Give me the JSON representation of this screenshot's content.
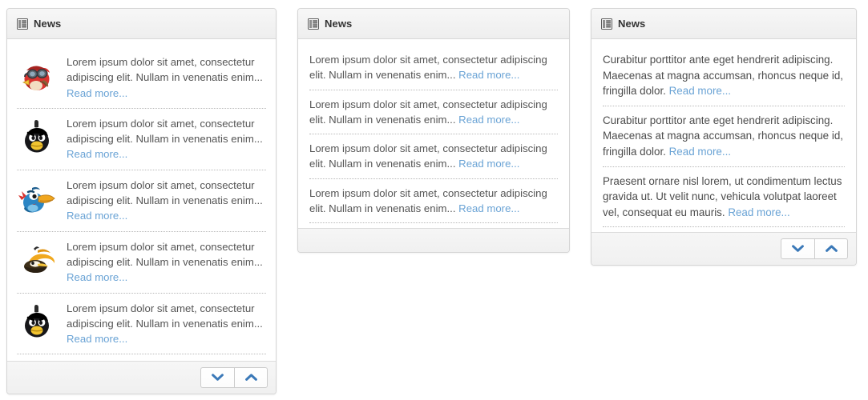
{
  "panels": [
    {
      "title": "News",
      "icon": "list-article-icon",
      "variant": "with-avatars",
      "items": [
        {
          "avatar": "red-bird-goggles-avatar",
          "text": "Lorem ipsum dolor sit amet, consectetur adipiscing elit. Nullam in venenatis enim... ",
          "read_more": "Read more..."
        },
        {
          "avatar": "black-bomb-bird-avatar",
          "text": "Lorem ipsum dolor sit amet, consectetur adipiscing elit. Nullam in venenatis enim... ",
          "read_more": "Read more..."
        },
        {
          "avatar": "blue-toucan-bird-avatar",
          "text": "Lorem ipsum dolor sit amet, consectetur adipiscing elit. Nullam in venenatis enim... ",
          "read_more": "Read more..."
        },
        {
          "avatar": "yellow-bird-avatar",
          "text": "Lorem ipsum dolor sit amet, consectetur adipiscing elit. Nullam in venenatis enim... ",
          "read_more": "Read more..."
        },
        {
          "avatar": "black-bomb-bird-avatar",
          "text": "Lorem ipsum dolor sit amet, consectetur adipiscing elit. Nullam in venenatis enim... ",
          "read_more": "Read more..."
        }
      ],
      "footer": {
        "has_buttons": true,
        "prev_icon": "chevron-down-icon",
        "next_icon": "chevron-up-icon"
      }
    },
    {
      "title": "News",
      "icon": "list-article-icon",
      "variant": "text-only",
      "items": [
        {
          "text": "Lorem ipsum dolor sit amet, consectetur adipiscing elit. Nullam in venenatis enim... ",
          "read_more": "Read more..."
        },
        {
          "text": "Lorem ipsum dolor sit amet, consectetur adipiscing elit. Nullam in venenatis enim... ",
          "read_more": "Read more..."
        },
        {
          "text": "Lorem ipsum dolor sit amet, consectetur adipiscing elit. Nullam in venenatis enim... ",
          "read_more": "Read more..."
        },
        {
          "text": "Lorem ipsum dolor sit amet, consectetur adipiscing elit. Nullam in venenatis enim... ",
          "read_more": "Read more..."
        }
      ],
      "footer": {
        "has_buttons": false
      }
    },
    {
      "title": "News",
      "icon": "list-article-icon",
      "variant": "text-only",
      "items": [
        {
          "text": "Curabitur porttitor ante eget hendrerit adipiscing. Maecenas at magna accumsan, rhoncus neque id, fringilla dolor. ",
          "read_more": "Read more..."
        },
        {
          "text": "Curabitur porttitor ante eget hendrerit adipiscing. Maecenas at magna accumsan, rhoncus neque id, fringilla dolor. ",
          "read_more": "Read more..."
        },
        {
          "text": "Praesent ornare nisl lorem, ut condimentum lectus gravida ut. Ut velit nunc, vehicula volutpat laoreet vel, consequat eu mauris. ",
          "read_more": "Read more..."
        }
      ],
      "footer": {
        "has_buttons": true,
        "prev_icon": "chevron-down-icon",
        "next_icon": "chevron-up-icon"
      }
    }
  ],
  "colors": {
    "link": "#6aa3d5",
    "text": "#555555",
    "title": "#333333",
    "panel_border": "#d5d5d5",
    "head_bg": "#eeeeee",
    "foot_bg": "#f1f1f1",
    "chevron": "#3b79b8",
    "separator": "#b9b9b9"
  }
}
